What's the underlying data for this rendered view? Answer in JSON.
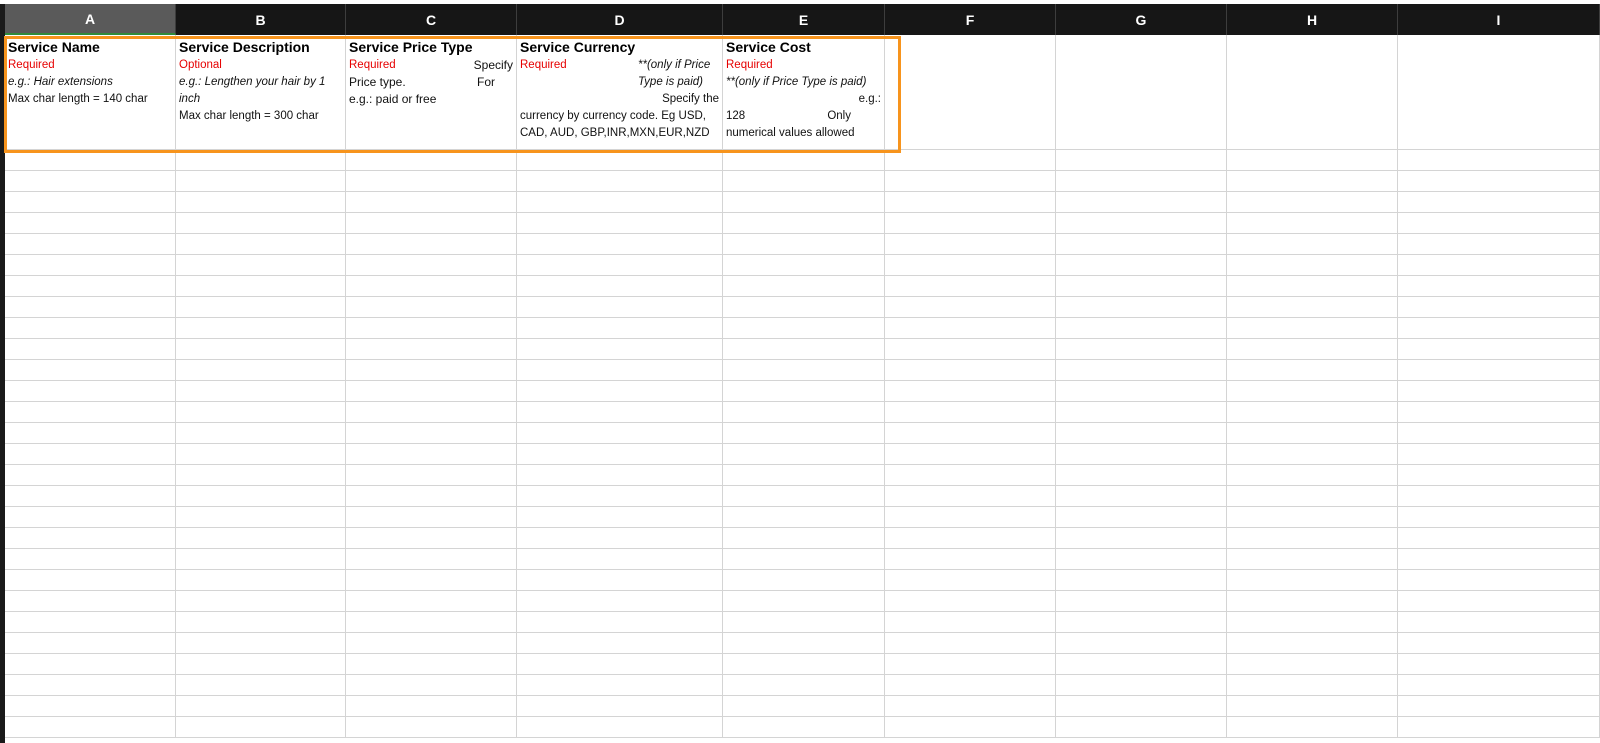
{
  "columns": [
    "A",
    "B",
    "C",
    "D",
    "E",
    "F",
    "G",
    "H",
    "I"
  ],
  "selected_column": "A",
  "header_cells": {
    "A": {
      "title": "Service Name",
      "status": "Required",
      "example": "e.g.: Hair extensions",
      "note": "Max char length = 140 char"
    },
    "B": {
      "title": "Service Description",
      "status": "Optional",
      "example": "e.g.: Lengthen your hair by 1 inch",
      "note": "Max char length = 300 char"
    },
    "C": {
      "title": "Service Price Type",
      "status": "Required",
      "text_a": "Specify",
      "text_b": "Price type.",
      "text_c": "For",
      "text_d": "e.g.:  paid or free"
    },
    "D": {
      "title": "Service Currency",
      "status": "Required",
      "condition": "**(only if Price Type is paid)",
      "text_a": "Specify the",
      "text_b": "currency by currency code. Eg USD, CAD, AUD, GBP,INR,MXN,EUR,NZD"
    },
    "E": {
      "title": "Service Cost",
      "status": "Required",
      "condition": "**(only if Price Type is paid)",
      "example_label": "e.g.:",
      "example_value": "128",
      "note_a": "Only",
      "note_b": "numerical values allowed"
    }
  },
  "colors": {
    "required": "#e60000",
    "highlight_border": "#f7941d",
    "header_bg": "#161616"
  }
}
